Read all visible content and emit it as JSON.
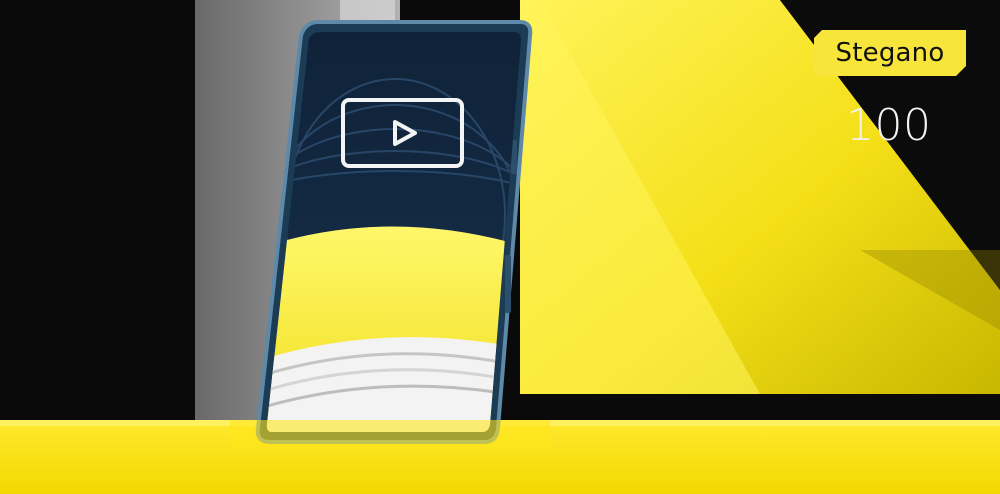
{
  "badge": {
    "label": "Stegano"
  },
  "counter": {
    "value": "100"
  },
  "scene": {
    "accent_color": "#f7e53b",
    "background_color": "#0a0a0a",
    "phone_screen_icon": "play-video-icon"
  }
}
